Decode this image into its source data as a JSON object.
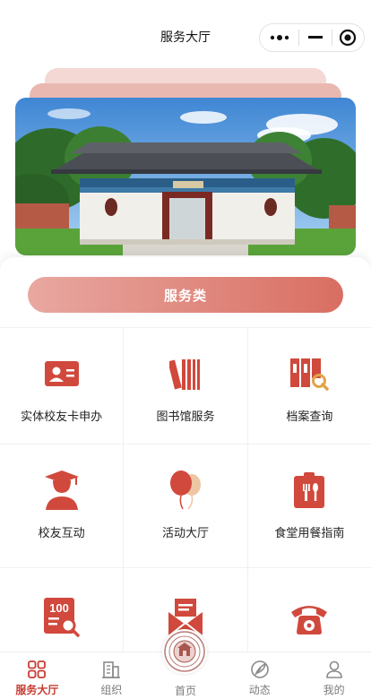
{
  "nav": {
    "title": "服务大厅"
  },
  "main": {
    "category": "服务类",
    "services": [
      {
        "label": "实体校友卡申办",
        "icon": "id-card-icon"
      },
      {
        "label": "图书馆服务",
        "icon": "books-icon"
      },
      {
        "label": "档案查询",
        "icon": "archive-search-icon"
      },
      {
        "label": "校友互动",
        "icon": "graduate-icon"
      },
      {
        "label": "活动大厅",
        "icon": "balloons-icon"
      },
      {
        "label": "食堂用餐指南",
        "icon": "dining-icon"
      },
      {
        "label": "",
        "icon": "score-search-icon"
      },
      {
        "label": "",
        "icon": "mail-icon"
      },
      {
        "label": "",
        "icon": "telephone-icon"
      }
    ]
  },
  "tabbar": {
    "items": [
      {
        "label": "服务大厅",
        "icon": "grid-icon",
        "active": true
      },
      {
        "label": "组织",
        "icon": "building-icon",
        "active": false
      },
      {
        "label": "首页",
        "icon": "emblem-icon",
        "active": false
      },
      {
        "label": "动态",
        "icon": "feather-icon",
        "active": false
      },
      {
        "label": "我的",
        "icon": "user-icon",
        "active": false
      }
    ]
  },
  "colors": {
    "accent": "#c63d33",
    "icon_red": "#d0493c",
    "pill_start": "#e8a8a1",
    "pill_end": "#d96e62"
  }
}
